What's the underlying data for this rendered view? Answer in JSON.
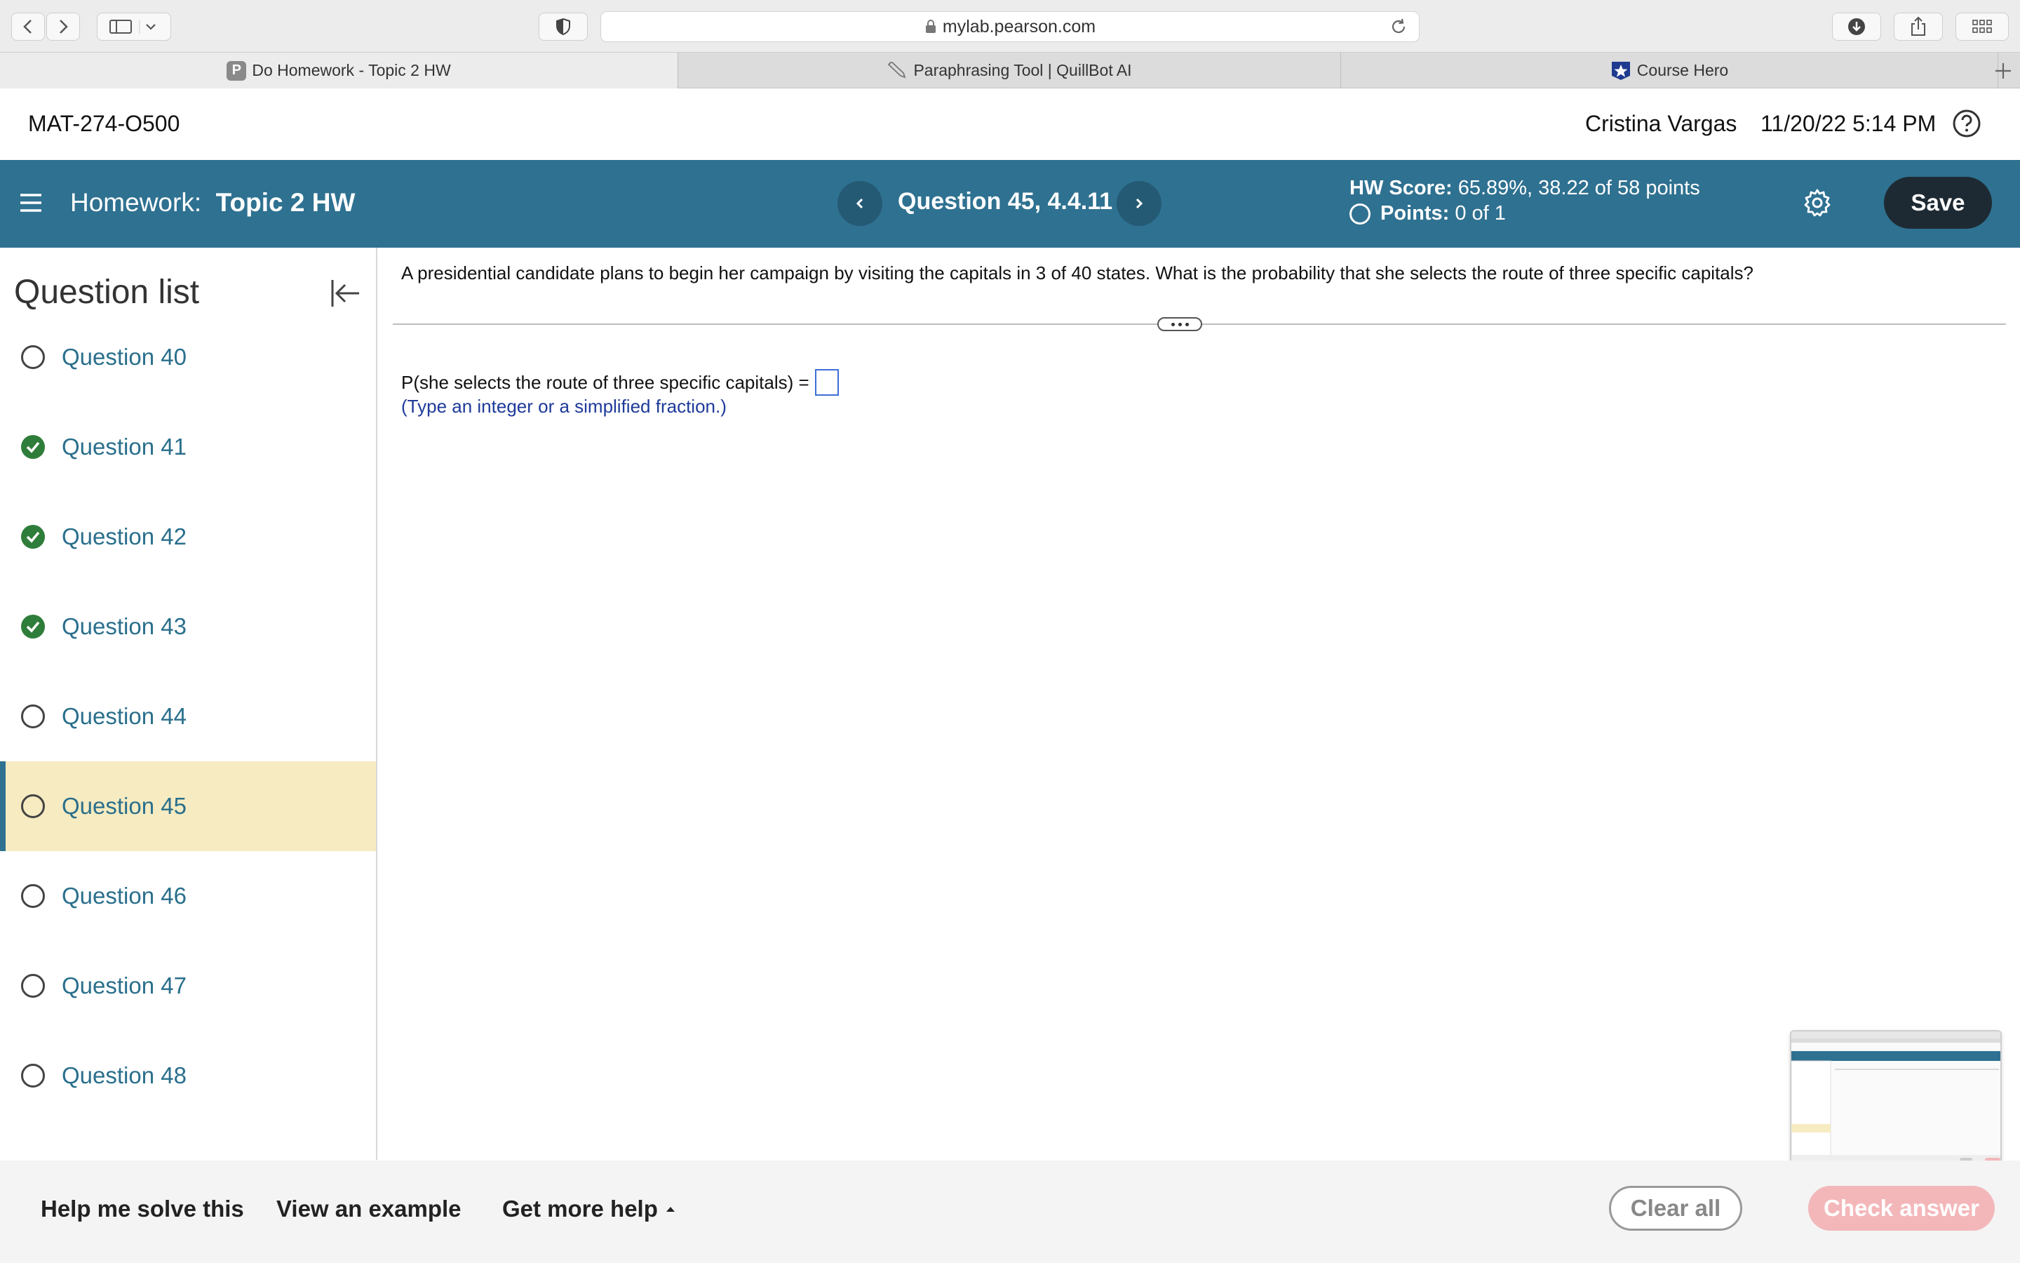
{
  "browser": {
    "url": "mylab.pearson.com",
    "tabs": [
      {
        "label": "Do Homework - Topic 2 HW",
        "favicon": "P"
      },
      {
        "label": "Paraphrasing Tool | QuillBot AI"
      },
      {
        "label": "Course Hero"
      }
    ]
  },
  "header": {
    "course_id": "MAT-274-O500",
    "user_name": "Cristina Vargas",
    "datetime": "11/20/22 5:14 PM"
  },
  "homework": {
    "prefix": "Homework:",
    "name": "Topic 2 HW",
    "question_label": "Question 45, 4.4.11",
    "score_label": "HW Score:",
    "score_value": "65.89%, 38.22 of 58 points",
    "points_label": "Points:",
    "points_value": "0 of 1",
    "save_label": "Save"
  },
  "sidebar": {
    "title": "Question list",
    "items": [
      {
        "label": "Question 40",
        "status": "unanswered"
      },
      {
        "label": "Question 41",
        "status": "correct"
      },
      {
        "label": "Question 42",
        "status": "correct"
      },
      {
        "label": "Question 43",
        "status": "correct"
      },
      {
        "label": "Question 44",
        "status": "unanswered"
      },
      {
        "label": "Question 45",
        "status": "current"
      },
      {
        "label": "Question 46",
        "status": "unanswered"
      },
      {
        "label": "Question 47",
        "status": "unanswered"
      },
      {
        "label": "Question 48",
        "status": "unanswered"
      }
    ]
  },
  "question": {
    "text": "A presidential candidate plans to begin her campaign by visiting the capitals in 3 of 40 states. What is the probability that she selects the route of three specific capitals?",
    "answer_prefix": "P(she selects the route of three specific capitals) =",
    "answer_value": "",
    "hint": "(Type an integer or a simplified fraction.)"
  },
  "footer": {
    "help_solve": "Help me solve this",
    "view_example": "View an example",
    "more_help": "Get more help",
    "clear_all": "Clear all",
    "check_answer": "Check answer"
  },
  "colors": {
    "brand_bar": "#2f7191",
    "current_row": "#f7ebc1",
    "correct": "#2f7d3a",
    "check_answer_disabled": "#f3b7ba"
  }
}
